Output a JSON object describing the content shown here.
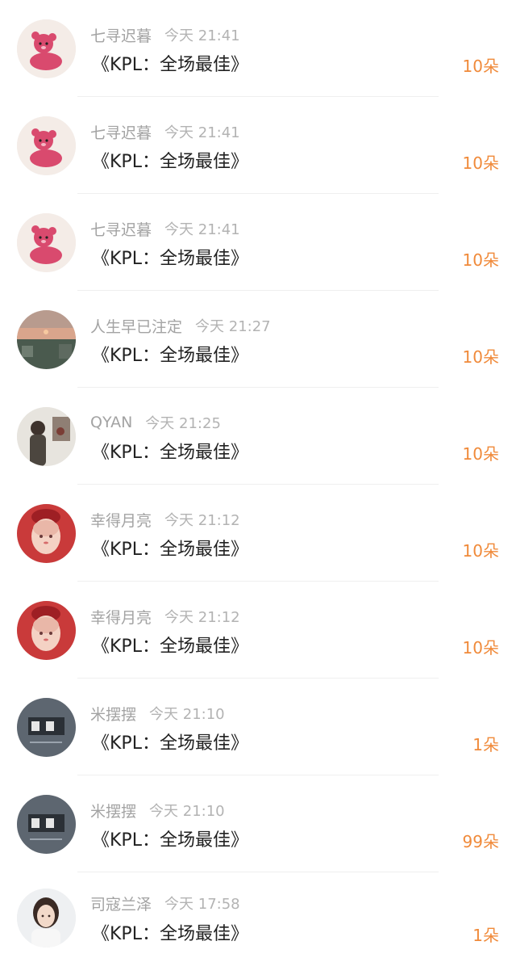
{
  "colors": {
    "name": "#a3a3a3",
    "time": "#b3b3b3",
    "title": "#222222",
    "amount": "#f08a3a"
  },
  "list": {
    "items": [
      {
        "name": "七寻迟暮",
        "time": "今天 21:41",
        "title": "《KPL：全场最佳》",
        "amount": "10朵",
        "avatar": "pink-bear-cartoon"
      },
      {
        "name": "七寻迟暮",
        "time": "今天 21:41",
        "title": "《KPL：全场最佳》",
        "amount": "10朵",
        "avatar": "pink-bear-cartoon"
      },
      {
        "name": "七寻迟暮",
        "time": "今天 21:41",
        "title": "《KPL：全场最佳》",
        "amount": "10朵",
        "avatar": "pink-bear-cartoon"
      },
      {
        "name": "人生早已注定",
        "time": "今天 21:27",
        "title": "《KPL：全场最佳》",
        "amount": "10朵",
        "avatar": "sunset-landscape"
      },
      {
        "name": "QYAN",
        "time": "今天 21:25",
        "title": "《KPL：全场最佳》",
        "amount": "10朵",
        "avatar": "person-photo"
      },
      {
        "name": "幸得月亮",
        "time": "今天 21:12",
        "title": "《KPL：全场最佳》",
        "amount": "10朵",
        "avatar": "anime-girl-red"
      },
      {
        "name": "幸得月亮",
        "time": "今天 21:12",
        "title": "《KPL：全场最佳》",
        "amount": "10朵",
        "avatar": "anime-girl-red"
      },
      {
        "name": "米摆摆",
        "time": "今天 21:10",
        "title": "《KPL：全场最佳》",
        "amount": "1朵",
        "avatar": "dark-text-tile"
      },
      {
        "name": "米摆摆",
        "time": "今天 21:10",
        "title": "《KPL：全场最佳》",
        "amount": "99朵",
        "avatar": "dark-text-tile"
      },
      {
        "name": "司寇兰泽",
        "time": "今天 17:58",
        "title": "《KPL：全场最佳》",
        "amount": "1朵",
        "avatar": "woman-portrait"
      }
    ]
  }
}
